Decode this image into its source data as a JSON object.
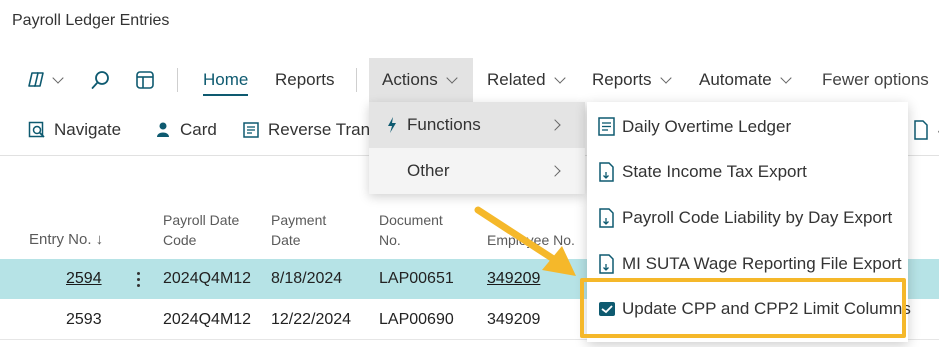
{
  "page": {
    "title": "Payroll Ledger Entries"
  },
  "ribbon": {
    "home": "Home",
    "reports_tab": "Reports",
    "actions": "Actions",
    "related": "Related",
    "reports": "Reports",
    "automate": "Automate",
    "fewer_options": "Fewer options"
  },
  "actionbar": {
    "navigate": "Navigate",
    "card": "Card",
    "reverse": "Reverse Trans",
    "cut_right": "4"
  },
  "submenu": {
    "functions": "Functions",
    "other": "Other"
  },
  "flyout": {
    "items": [
      "Daily Overtime Ledger",
      "State Income Tax Export",
      "Payroll Code Liability by Day Export",
      "MI SUTA Wage Reporting File Export",
      "Update CPP and CPP2 Limit Columns"
    ]
  },
  "grid": {
    "headers": {
      "entry_no": "Entry No. ↓",
      "payroll_date_code_1": "Payroll Date",
      "payroll_date_code_2": "Code",
      "payment_date_1": "Payment",
      "payment_date_2": "Date",
      "document_no_1": "Document",
      "document_no_2": "No.",
      "employee_no": "Employee No."
    },
    "rows": [
      {
        "entry_no": "2594",
        "payroll_date_code": "2024Q4M12",
        "payment_date": "8/18/2024",
        "document_no": "LAP00651",
        "employee_no": "349209"
      },
      {
        "entry_no": "2593",
        "payroll_date_code": "2024Q4M12",
        "payment_date": "12/22/2024",
        "document_no": "LAP00690",
        "employee_no": "349209"
      }
    ]
  },
  "colors": {
    "accent": "#0e5a70",
    "selected_row": "#b6e3e6",
    "highlight": "#f5b82a",
    "arrow": "#f5b82a"
  }
}
